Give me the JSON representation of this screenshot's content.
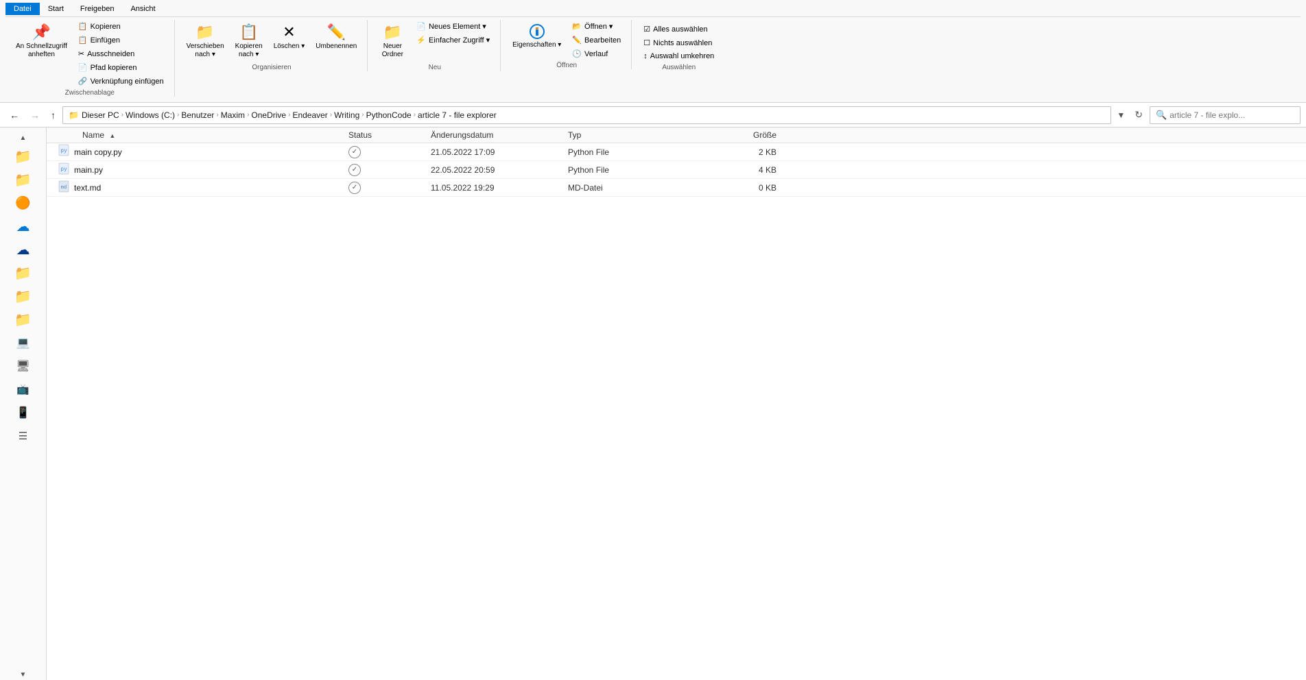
{
  "window": {
    "title": "article 7 - file explorer"
  },
  "tabs": [
    {
      "label": "Datei",
      "active": true
    },
    {
      "label": "Start",
      "active": false
    },
    {
      "label": "Freigeben",
      "active": false
    },
    {
      "label": "Ansicht",
      "active": false
    }
  ],
  "ribbon": {
    "groups": [
      {
        "id": "zwischenablage",
        "label": "Zwischenablage",
        "buttons_large": [
          {
            "label": "An Schnellzugriff\nanheften",
            "icon": "📌",
            "name": "pin-quickaccess-button"
          }
        ],
        "buttons_small": [
          {
            "label": "Kopieren",
            "icon": "📋",
            "name": "copy-button"
          },
          {
            "label": "Einfügen",
            "icon": "📋",
            "name": "paste-button"
          },
          {
            "label": "Ausschneiden",
            "icon": "✂",
            "name": "cut-button"
          },
          {
            "label": "Pfad kopieren",
            "icon": "📄",
            "name": "copy-path-button"
          },
          {
            "label": "Verknüpfung einfügen",
            "icon": "🔗",
            "name": "paste-shortcut-button"
          }
        ]
      },
      {
        "id": "organisieren",
        "label": "Organisieren",
        "buttons_large": [
          {
            "label": "Verschieben\nnach",
            "icon": "📁",
            "name": "move-to-button"
          },
          {
            "label": "Kopieren\nnach",
            "icon": "📋",
            "name": "copy-to-button"
          },
          {
            "label": "Löschen",
            "icon": "🗑",
            "name": "delete-button"
          },
          {
            "label": "Umbenennen",
            "icon": "✏",
            "name": "rename-button"
          }
        ]
      },
      {
        "id": "neu",
        "label": "Neu",
        "buttons_large": [
          {
            "label": "Neuer\nOrdner",
            "icon": "📁",
            "name": "new-folder-button"
          }
        ],
        "buttons_small": [
          {
            "label": "Neues Element",
            "icon": "📄",
            "name": "new-item-button"
          },
          {
            "label": "Einfacher Zugriff",
            "icon": "⚡",
            "name": "easy-access-button"
          }
        ]
      },
      {
        "id": "oeffnen",
        "label": "Öffnen",
        "buttons_large": [
          {
            "label": "Eigenschaften",
            "icon": "ℹ",
            "name": "properties-button"
          }
        ],
        "buttons_small": [
          {
            "label": "Öffnen",
            "icon": "📂",
            "name": "open-button"
          },
          {
            "label": "Bearbeiten",
            "icon": "✏",
            "name": "edit-button"
          },
          {
            "label": "Verlauf",
            "icon": "🕒",
            "name": "history-button"
          }
        ]
      },
      {
        "id": "auswaehlen",
        "label": "Auswählen",
        "buttons_small": [
          {
            "label": "Alles auswählen",
            "icon": "☑",
            "name": "select-all-button"
          },
          {
            "label": "Nichts auswählen",
            "icon": "☐",
            "name": "select-none-button"
          },
          {
            "label": "Auswahl umkehren",
            "icon": "↕",
            "name": "invert-selection-button"
          }
        ]
      }
    ]
  },
  "address_bar": {
    "breadcrumb": [
      {
        "label": "Dieser PC",
        "name": "bc-this-pc"
      },
      {
        "label": "Windows (C:)",
        "name": "bc-windows-c"
      },
      {
        "label": "Benutzer",
        "name": "bc-benutzer"
      },
      {
        "label": "Maxim",
        "name": "bc-maxim"
      },
      {
        "label": "OneDrive",
        "name": "bc-onedrive"
      },
      {
        "label": "Endeaver",
        "name": "bc-endeaver"
      },
      {
        "label": "Writing",
        "name": "bc-writing"
      },
      {
        "label": "PythonCode",
        "name": "bc-pythoncode"
      },
      {
        "label": "article 7 - file explorer",
        "name": "bc-article7"
      }
    ],
    "search_placeholder": "article 7 - file explo..."
  },
  "file_list": {
    "columns": [
      {
        "label": "Name",
        "key": "name",
        "sort_arrow": true
      },
      {
        "label": "Status",
        "key": "status"
      },
      {
        "label": "Änderungsdatum",
        "key": "date"
      },
      {
        "label": "Typ",
        "key": "type"
      },
      {
        "label": "Größe",
        "key": "size"
      }
    ],
    "files": [
      {
        "name": "main copy.py",
        "icon": "🐍",
        "icon_type": "py",
        "status": "✓",
        "date": "21.05.2022 17:09",
        "type": "Python File",
        "size": "2 KB"
      },
      {
        "name": "main.py",
        "icon": "🐍",
        "icon_type": "py",
        "status": "✓",
        "date": "22.05.2022 20:59",
        "type": "Python File",
        "size": "4 KB"
      },
      {
        "name": "text.md",
        "icon": "📝",
        "icon_type": "md",
        "status": "✓",
        "date": "11.05.2022 19:29",
        "type": "MD-Datei",
        "size": "0 KB"
      }
    ]
  },
  "sidebar": {
    "items": [
      {
        "icon": "▲",
        "name": "scroll-up-sidebar"
      },
      {
        "icon": "📁",
        "color": "gold",
        "name": "sidebar-folder-1"
      },
      {
        "icon": "📁",
        "color": "gold",
        "name": "sidebar-folder-2"
      },
      {
        "icon": "🔵",
        "name": "sidebar-orange-ball"
      },
      {
        "icon": "☁",
        "color": "blue",
        "name": "sidebar-onedrive-1"
      },
      {
        "icon": "☁",
        "color": "darkblue",
        "name": "sidebar-onedrive-2"
      },
      {
        "icon": "📁",
        "color": "gold",
        "name": "sidebar-folder-3"
      },
      {
        "icon": "📁",
        "color": "gold",
        "name": "sidebar-folder-4"
      },
      {
        "icon": "📁",
        "color": "gold",
        "name": "sidebar-folder-5"
      },
      {
        "icon": "💻",
        "name": "sidebar-computer"
      },
      {
        "icon": "🖥",
        "name": "sidebar-monitor"
      },
      {
        "icon": "📺",
        "name": "sidebar-screen"
      },
      {
        "icon": "📱",
        "name": "sidebar-device"
      },
      {
        "icon": "▼",
        "name": "scroll-down-sidebar"
      }
    ]
  }
}
